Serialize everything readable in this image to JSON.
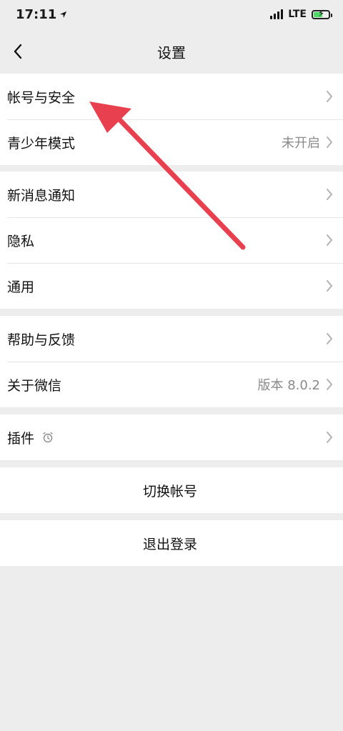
{
  "status_bar": {
    "time": "17:11",
    "network": "LTE"
  },
  "nav": {
    "title": "设置"
  },
  "groups": [
    {
      "items": [
        {
          "label": "帐号与安全",
          "value": ""
        },
        {
          "label": "青少年模式",
          "value": "未开启"
        }
      ]
    },
    {
      "items": [
        {
          "label": "新消息通知",
          "value": ""
        },
        {
          "label": "隐私",
          "value": ""
        },
        {
          "label": "通用",
          "value": ""
        }
      ]
    },
    {
      "items": [
        {
          "label": "帮助与反馈",
          "value": ""
        },
        {
          "label": "关于微信",
          "value": "版本 8.0.2"
        }
      ]
    },
    {
      "items": [
        {
          "label": "插件",
          "value": ""
        }
      ]
    }
  ],
  "actions": {
    "switch_account": "切换帐号",
    "logout": "退出登录"
  },
  "colors": {
    "background": "#ededed",
    "card": "#ffffff",
    "annotation_arrow": "#e8404f",
    "battery_fill": "#4cd964"
  },
  "icons": {
    "back": "chevron-left-icon",
    "row_arrow": "chevron-right-icon",
    "plugin_badge": "alarm-clock-icon"
  }
}
